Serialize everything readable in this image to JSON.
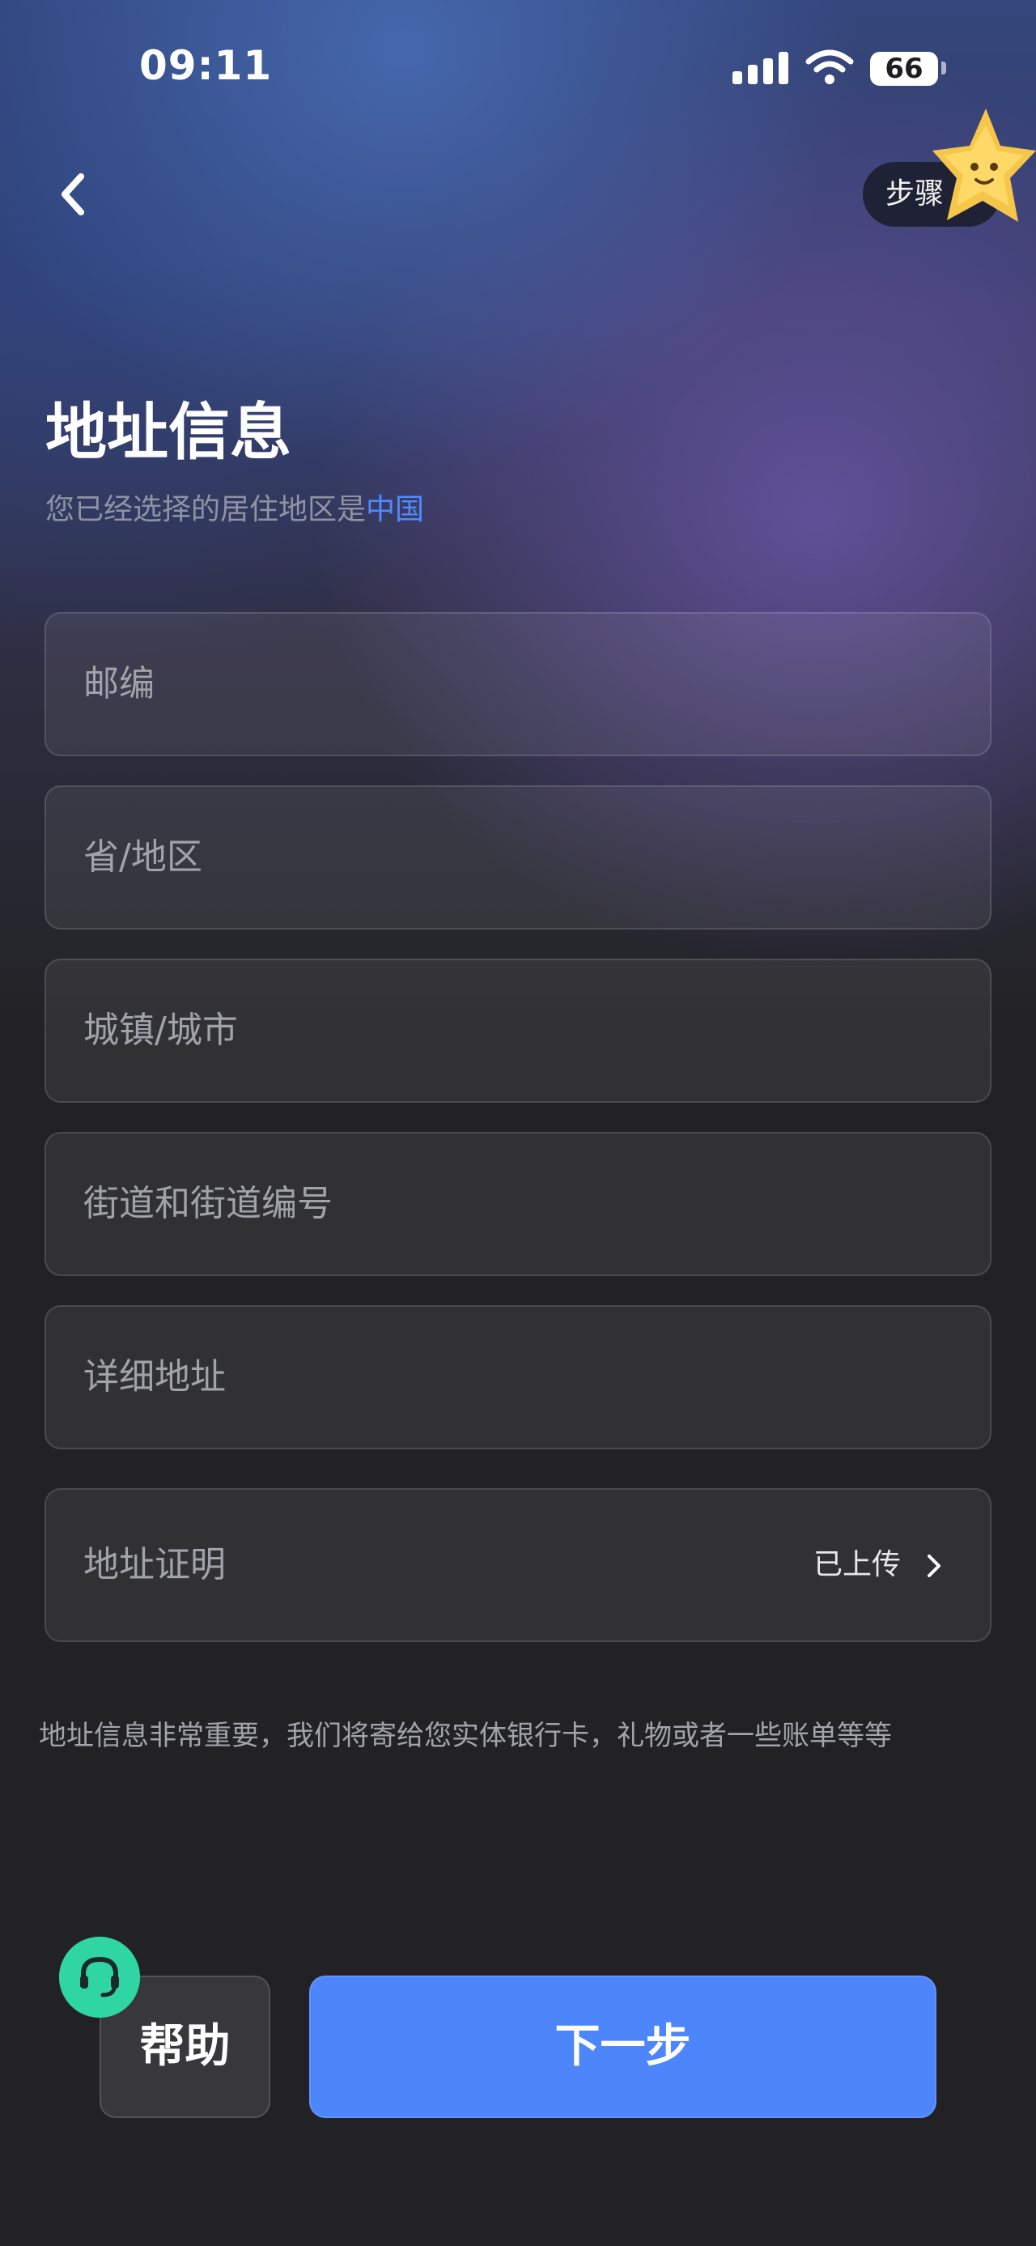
{
  "status_bar": {
    "time": "09:11",
    "battery": "66",
    "icons": [
      "signal-icon",
      "wifi-icon",
      "battery-icon"
    ]
  },
  "header": {
    "back_icon": "chevron-left-icon",
    "step_label": "步骤 4"
  },
  "title": "地址信息",
  "subtitle": {
    "prefix": "您已经选择的居住地区是",
    "region": "中国"
  },
  "form": {
    "postal_code_placeholder": "邮编",
    "province_placeholder": "省/地区",
    "city_placeholder": "城镇/城市",
    "street_placeholder": "街道和街道编号",
    "detail_placeholder": "详细地址",
    "proof": {
      "label": "地址证明",
      "status": "已上传",
      "icon": "chevron-right-icon"
    }
  },
  "notice": "地址信息非常重要，我们将寄给您实体银行卡，礼物或者一些账单等等",
  "actions": {
    "help_label": "帮助",
    "support_icon": "headset-icon",
    "next_label": "下一步"
  },
  "colors": {
    "accent": "#4c86fa",
    "link": "#4f8bff",
    "support": "#2fd6a4",
    "background": "#222224"
  }
}
